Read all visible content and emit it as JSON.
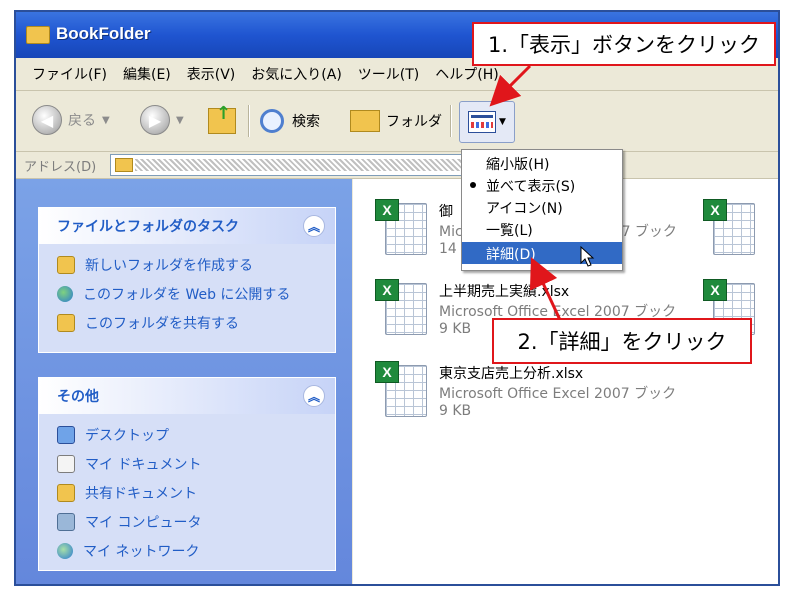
{
  "window": {
    "title": "BookFolder"
  },
  "menu": [
    "ファイル(F)",
    "編集(E)",
    "表示(V)",
    "お気に入り(A)",
    "ツール(T)",
    "ヘルプ(H)"
  ],
  "toolbar": {
    "back_label": "戻る",
    "search_label": "検索",
    "folders_label": "フォルダ"
  },
  "address": {
    "label": "アドレス(D)"
  },
  "tasks_panel": {
    "title": "ファイルとフォルダのタスク",
    "items": [
      "新しいフォルダを作成する",
      "このフォルダを Web に公開する",
      "このフォルダを共有する"
    ]
  },
  "other_panel": {
    "title": "その他",
    "items": [
      "デスクトップ",
      "マイ ドキュメント",
      "共有ドキュメント",
      "マイ コンピュータ",
      "マイ ネットワーク"
    ]
  },
  "files": [
    {
      "name": "御",
      "type": "Mic",
      "type_tail": "07 ブック",
      "size": "14"
    },
    {
      "name": "上半期売上実績.xlsx",
      "type": "Microsoft Office Excel 2007 ブック",
      "size": "9 KB"
    },
    {
      "name": "東京支店売上分析.xlsx",
      "type": "Microsoft Office Excel 2007 ブック",
      "size": "9 KB"
    }
  ],
  "view_menu": [
    "縮小版(H)",
    "並べて表示(S)",
    "アイコン(N)",
    "一覧(L)",
    "詳細(D)"
  ],
  "annotations": {
    "step1": "1.「表示」ボタンをクリック",
    "step2": "2.「詳細」をクリック"
  },
  "colors": {
    "highlight": "#316ac5",
    "annotation_red": "#e0161b",
    "task_link": "#215dc6"
  }
}
